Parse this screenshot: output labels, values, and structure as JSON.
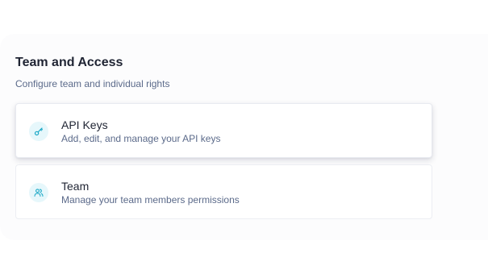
{
  "section": {
    "title": "Team and Access",
    "subtitle": "Configure team and individual rights"
  },
  "cards": [
    {
      "icon": "key-icon",
      "title": "API Keys",
      "description": "Add, edit, and manage your API keys"
    },
    {
      "icon": "users-icon",
      "title": "Team",
      "description": "Manage your team members permissions"
    }
  ],
  "colors": {
    "icon_accent": "#1ba8c6",
    "icon_background": "#e6f7fb",
    "title_text": "#1f2433",
    "secondary_text": "#5b6a8a"
  }
}
